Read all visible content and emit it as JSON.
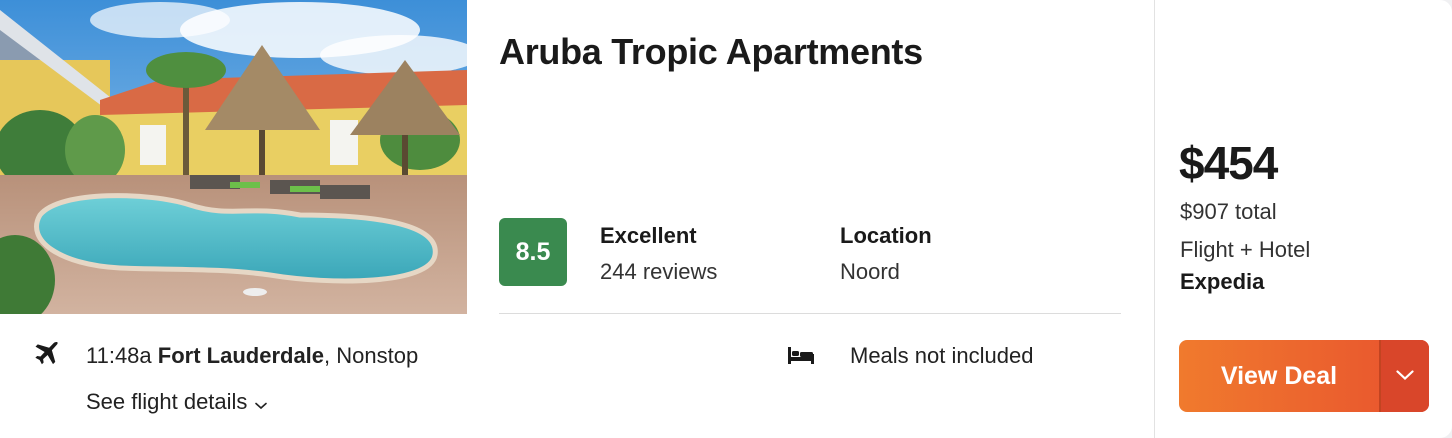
{
  "hotel": {
    "name": "Aruba Tropic Apartments",
    "photo_alt": "Aruba Tropic Apartments pool",
    "score": "8.5",
    "rating_label": "Excellent",
    "reviews": "244 reviews",
    "location_label": "Location",
    "location": "Noord"
  },
  "flight": {
    "time": "11:48a",
    "origin": "Fort Lauderdale",
    "stops": ", Nonstop",
    "details_label": "See flight details",
    "icon": "airplane-icon"
  },
  "meals": {
    "text": "Meals not included",
    "icon": "bed-icon"
  },
  "pricing": {
    "price": "$454",
    "total": "$907 total",
    "package": "Flight + Hotel",
    "provider": "Expedia",
    "cta_label": "View Deal"
  },
  "colors": {
    "score_badge": "#3a8a4f",
    "cta_start": "#f07a2d",
    "cta_end": "#e8522f"
  }
}
